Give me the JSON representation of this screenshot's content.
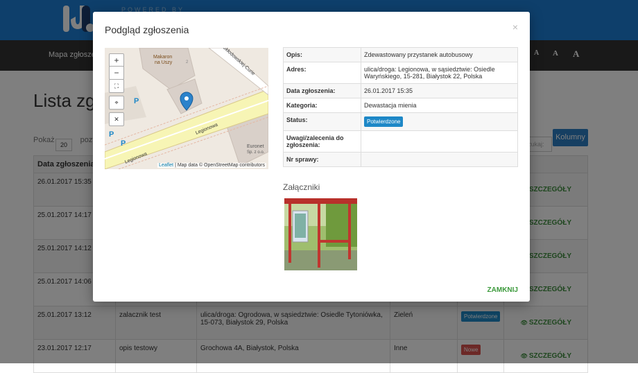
{
  "header": {
    "powered_by": "POWERED BY",
    "nav_item": "Mapa zgłoszeń",
    "font_size_labels": [
      "A",
      "A",
      "A"
    ]
  },
  "page": {
    "title": "Lista zgłoszeń",
    "show_label": "Pokaż",
    "show_value": "20",
    "show_suffix": "pozycji",
    "search_placeholder": "Szukaj:",
    "columns_button": "Kolumny",
    "table_header_date": "Data zgłoszenia"
  },
  "rows": [
    {
      "date": "26.01.2017 15:35",
      "desc": "",
      "address": "",
      "category": "",
      "status": "",
      "status_class": "",
      "details": "SZCZEGÓŁY"
    },
    {
      "date": "25.01.2017 14:17",
      "desc": "",
      "address": "",
      "category": "",
      "status": "",
      "status_class": "",
      "details": "SZCZEGÓŁY"
    },
    {
      "date": "25.01.2017 14:12",
      "desc": "",
      "address": "",
      "category": "",
      "status": "",
      "status_class": "",
      "details": "SZCZEGÓŁY"
    },
    {
      "date": "25.01.2017 14:06",
      "desc": "",
      "address": "",
      "category": "",
      "status": "",
      "status_class": "",
      "details": "SZCZEGÓŁY"
    },
    {
      "date": "25.01.2017 13:12",
      "desc": "zalacznik test",
      "address": "ulica/droga: Ogrodowa, w sąsiedztwie: Osiedle Tytoniówka, 15-073, Białystok 29, Polska",
      "category": "Zieleń",
      "status": "Potwierdzone",
      "status_class": "b-conf",
      "details": "SZCZEGÓŁY"
    },
    {
      "date": "23.01.2017 12:17",
      "desc": "opis testowy",
      "address": "Grochowa 4A, Białystok, Polska",
      "category": "Inne",
      "status": "Nowe",
      "status_class": "b-new",
      "details": "SZCZEGÓŁY"
    }
  ],
  "modal": {
    "title": "Podgląd zgłoszenia",
    "close_icon": "×",
    "fields": [
      {
        "label": "Opis:",
        "value": "Zdewastowany przystanek autobusowy"
      },
      {
        "label": "Adres:",
        "value": "ulica/droga: Legionowa, w sąsiedztwie: Osiedle Waryńskiego, 15-281, Białystok 22, Polska"
      },
      {
        "label": "Data zgłoszenia:",
        "value": "26.01.2017 15:35"
      },
      {
        "label": "Kategoria:",
        "value": "Dewastacja mienia"
      },
      {
        "label": "Status:",
        "value": "Potwierdzone"
      },
      {
        "label": "Uwagi/zalecenia do zgłoszenia:",
        "value": ""
      },
      {
        "label": "Nr sprawy:",
        "value": ""
      }
    ],
    "attachments_title": "Załączniki",
    "close_button": "ZAMKNIJ",
    "map": {
      "zoom_in": "+",
      "zoom_out": "−",
      "leaflet": "Leaflet",
      "attribution": "| Map data © OpenStreetMap contributors",
      "labels": {
        "place1": "Makaron",
        "place1b": "na Uszy",
        "road1": "Legionowa",
        "road2": "Legionowa",
        "road3": "Skłodowskiej-Curie",
        "shop": "Euronet",
        "shop2": "Sp. z o.o.",
        "p1": "P",
        "p2": "P",
        "p3": "P",
        "num": "2"
      }
    }
  },
  "colors": {
    "topbar": "#1c7fd6",
    "navbar": "#333333",
    "confirmed": "#1e88c7",
    "new": "#d9534f",
    "details": "#3c8d3c"
  }
}
